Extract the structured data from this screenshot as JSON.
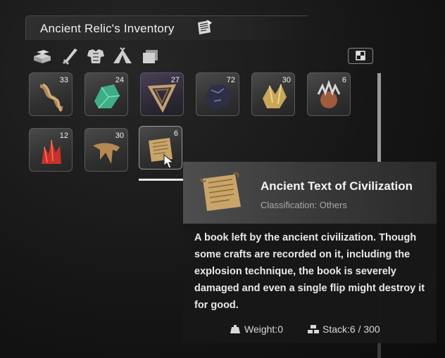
{
  "window": {
    "title": "Ancient Relic's Inventory"
  },
  "categories": [
    {
      "icon": "materials-icon"
    },
    {
      "icon": "weapons-icon"
    },
    {
      "icon": "armor-icon"
    },
    {
      "icon": "camp-icon"
    },
    {
      "icon": "misc-icon"
    }
  ],
  "sort_button": {
    "icon": "grid-sort-icon"
  },
  "slots": [
    {
      "icon": "rope-icon",
      "qty": "33"
    },
    {
      "icon": "green-crystal-icon",
      "qty": "24"
    },
    {
      "icon": "relic-frame-icon",
      "qty": "27"
    },
    {
      "icon": "dark-ore-icon",
      "qty": "72"
    },
    {
      "icon": "gold-crystal-icon",
      "qty": "30"
    },
    {
      "icon": "spiky-shell-icon",
      "qty": "6"
    },
    {
      "icon": "red-crystal-icon",
      "qty": "12"
    },
    {
      "icon": "fang-icon",
      "qty": "30"
    },
    {
      "icon": "scroll-icon",
      "qty": "6"
    }
  ],
  "tooltip": {
    "name": "Ancient Text of Civilization",
    "classification": "Classification: Others",
    "description": "A book left by the ancient civilization. Though some crafts are recorded on it, including the explosion technique, the book is severely damaged and even a single flip might destroy it for good.",
    "weight": "Weight:0",
    "stack": "Stack:6 / 300"
  },
  "colors": {
    "selected_underline": "#e8e8e8",
    "rare_slot": "#4b3f57"
  }
}
